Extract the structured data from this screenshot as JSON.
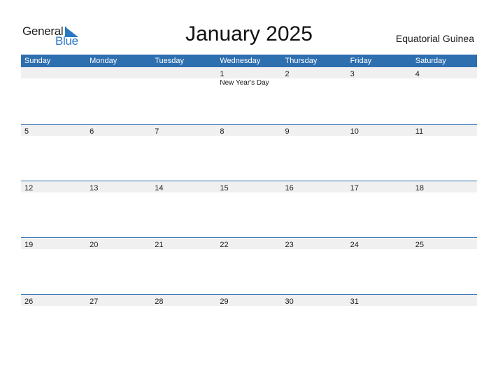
{
  "logo": {
    "text_general": "General",
    "text_blue": "Blue",
    "icon": "triangle-flag-icon"
  },
  "title": "January 2025",
  "country": "Equatorial Guinea",
  "colors": {
    "header_bg": "#2e6fb0",
    "date_strip_bg": "#f0f0f0",
    "logo_blue": "#2a78c2"
  },
  "weekdays": [
    "Sunday",
    "Monday",
    "Tuesday",
    "Wednesday",
    "Thursday",
    "Friday",
    "Saturday"
  ],
  "weeks": [
    {
      "days": [
        "",
        "",
        "",
        "1",
        "2",
        "3",
        "4"
      ],
      "events": [
        "",
        "",
        "",
        "New Year's Day",
        "",
        "",
        ""
      ]
    },
    {
      "days": [
        "5",
        "6",
        "7",
        "8",
        "9",
        "10",
        "11"
      ],
      "events": [
        "",
        "",
        "",
        "",
        "",
        "",
        ""
      ]
    },
    {
      "days": [
        "12",
        "13",
        "14",
        "15",
        "16",
        "17",
        "18"
      ],
      "events": [
        "",
        "",
        "",
        "",
        "",
        "",
        ""
      ]
    },
    {
      "days": [
        "19",
        "20",
        "21",
        "22",
        "23",
        "24",
        "25"
      ],
      "events": [
        "",
        "",
        "",
        "",
        "",
        "",
        ""
      ]
    },
    {
      "days": [
        "26",
        "27",
        "28",
        "29",
        "30",
        "31",
        ""
      ],
      "events": [
        "",
        "",
        "",
        "",
        "",
        "",
        ""
      ]
    }
  ]
}
